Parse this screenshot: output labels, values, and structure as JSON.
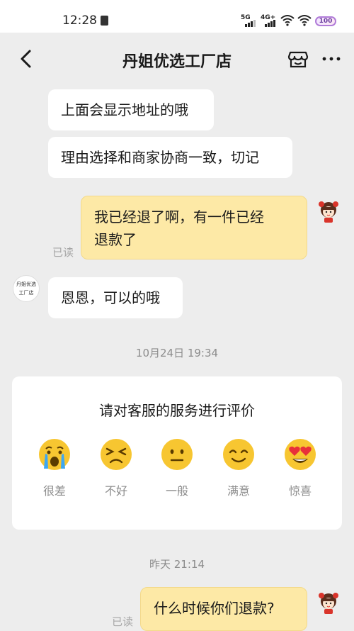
{
  "status_bar": {
    "time": "12:28",
    "network_1": "5G",
    "network_2": "4G+",
    "battery": "100"
  },
  "header": {
    "title": "丹姐优选工厂店",
    "back_icon": "chevron-left-icon",
    "store_icon": "store-icon",
    "more_icon": "more-horizontal-icon"
  },
  "messages": [
    {
      "from": "shop",
      "text": "上面会显示地址的哦"
    },
    {
      "from": "shop",
      "text": "理由选择和商家协商一致，切记"
    },
    {
      "from": "me",
      "text_line1": "我已经退了啊，有一件已经",
      "text_line2": "退款了",
      "status": "已读"
    },
    {
      "from": "shop",
      "text": "恩恩，可以的哦"
    }
  ],
  "shop_avatar": {
    "line1": "丹姐优选",
    "line2": "工厂店"
  },
  "timestamp_1": "10月24日 19:34",
  "rating": {
    "title": "请对客服的服务进行评价",
    "options": [
      {
        "label": "很差",
        "icon": "crying-face-icon"
      },
      {
        "label": "不好",
        "icon": "annoyed-face-icon"
      },
      {
        "label": "一般",
        "icon": "neutral-face-icon"
      },
      {
        "label": "满意",
        "icon": "smiling-face-icon"
      },
      {
        "label": "惊喜",
        "icon": "heart-eyes-face-icon"
      }
    ]
  },
  "timestamp_2": "昨天 21:14",
  "last_message": {
    "text": "什么时候你们退款?",
    "status": "已读"
  },
  "colors": {
    "background": "#ededed",
    "my_bubble": "#fde9a6",
    "shop_bubble": "#ffffff",
    "emoji_yellow": "#f7c631"
  }
}
